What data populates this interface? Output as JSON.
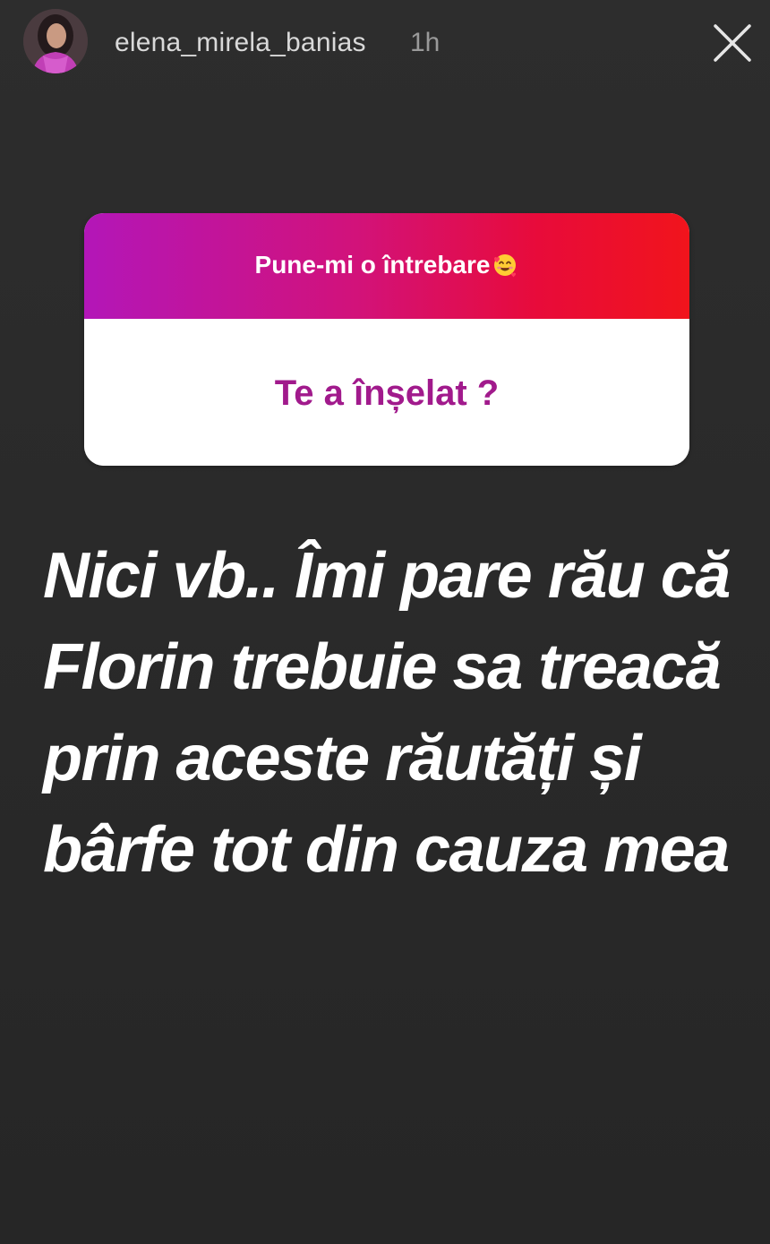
{
  "header": {
    "username": "elena_mirela_banias",
    "time": "1h",
    "avatar_icon": "profile-avatar",
    "close_icon": "close-x-icon"
  },
  "sticker": {
    "prompt": "Pune-mi o întrebare",
    "prompt_emoji": "smiling-face-with-hearts-emoji",
    "answer": "Te a înșelat ?",
    "gradient_colors": [
      "#b316b8",
      "#d2127a",
      "#e80b3a",
      "#f1141c"
    ],
    "answer_color": "#a11a8c"
  },
  "reply": {
    "lines": [
      "Nici vb.. Îmi pare rău că",
      "Florin trebuie sa treacă",
      "prin aceste răutăți și",
      "bârfe tot din cauza mea"
    ]
  },
  "colors": {
    "background": "#2b2b2b",
    "text": "#ffffff"
  }
}
